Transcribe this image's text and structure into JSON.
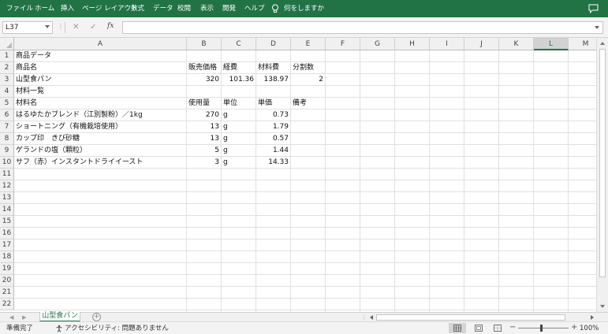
{
  "ribbon": {
    "tabs": [
      "ファイル",
      "ホーム",
      "挿入",
      "ページ レイアウト",
      "数式",
      "データ",
      "校閲",
      "表示",
      "開発",
      "ヘルプ"
    ],
    "tell_me": "何をしますか",
    "bg_color": "#217346"
  },
  "formula_bar": {
    "name_box": "L37",
    "formula": "",
    "fx_label": "fx"
  },
  "grid": {
    "columns": [
      "A",
      "B",
      "C",
      "D",
      "E",
      "F",
      "G",
      "H",
      "I",
      "J",
      "K",
      "L",
      "M"
    ],
    "selected_column": "L",
    "row_numbers": [
      "1",
      "2",
      "3",
      "4",
      "5",
      "6",
      "7",
      "8",
      "9",
      "10",
      "11",
      "12",
      "13",
      "14",
      "15",
      "16",
      "17",
      "18",
      "19",
      "20",
      "21",
      "22"
    ],
    "rows": [
      [
        "商品データ",
        "",
        "",
        "",
        ""
      ],
      [
        "商品名",
        "販売価格",
        "経費",
        "材料費",
        "分割数"
      ],
      [
        "山型食パン",
        "320",
        "101.36",
        "138.97",
        "2"
      ],
      [
        "材料一覧",
        "",
        "",
        "",
        ""
      ],
      [
        "材料名",
        "使用量",
        "単位",
        "単価",
        "備考"
      ],
      [
        "はるゆたかブレンド（江別製粉）／1kg",
        "270",
        "g",
        "0.73",
        ""
      ],
      [
        "ショートニング（有機栽培使用）",
        "13",
        "g",
        "1.79",
        ""
      ],
      [
        "カップ印　きび砂糖",
        "13",
        "g",
        "0.57",
        ""
      ],
      [
        "ゲランドの塩（顆粒）",
        "5",
        "g",
        "1.44",
        ""
      ],
      [
        "サフ（赤）インスタントドライイースト",
        "3",
        "g",
        "14.33",
        ""
      ]
    ]
  },
  "sheets": {
    "active": "山型食パン",
    "add_label": "+"
  },
  "status_bar": {
    "ready": "準備完了",
    "accessibility": "アクセシビリティ: 問題ありません",
    "zoom": "100%",
    "zoom_minus": "−",
    "zoom_plus": "+"
  }
}
